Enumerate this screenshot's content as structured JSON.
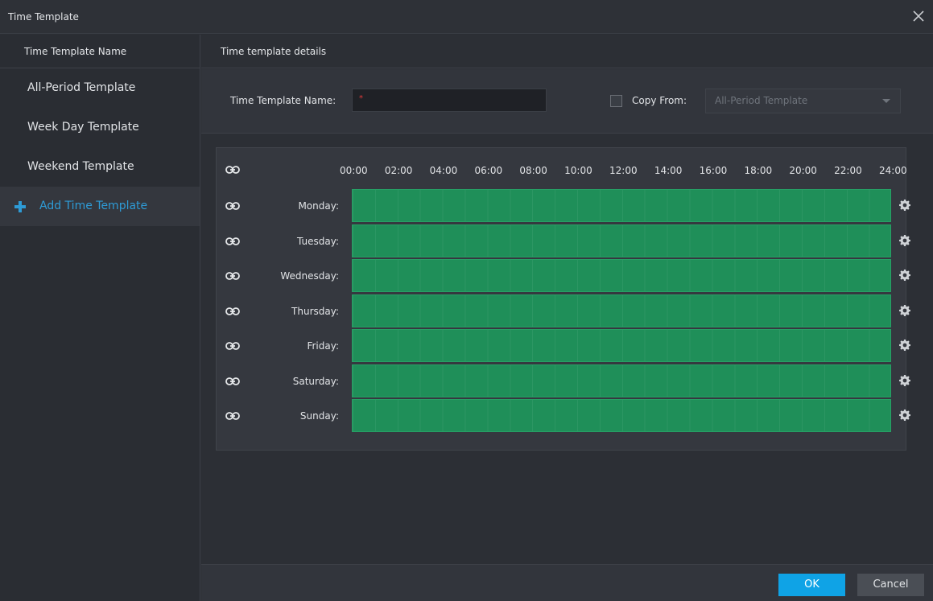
{
  "window": {
    "title": "Time Template"
  },
  "sidebar": {
    "header": "Time Template Name",
    "items": [
      {
        "label": "All-Period Template"
      },
      {
        "label": "Week Day Template"
      },
      {
        "label": "Weekend Template"
      }
    ],
    "add_label": "Add Time Template"
  },
  "details": {
    "header": "Time template details",
    "name_label": "Time Template Name:",
    "name_value": "",
    "required_mark": "*",
    "copy_from_label": "Copy From:",
    "copy_from_checked": false,
    "copy_from_selected": "All-Period Template"
  },
  "schedule": {
    "hours": [
      "00:00",
      "02:00",
      "04:00",
      "06:00",
      "08:00",
      "10:00",
      "12:00",
      "14:00",
      "16:00",
      "18:00",
      "20:00",
      "22:00",
      "24:00"
    ],
    "days": [
      {
        "label": "Monday:",
        "start": "00:00",
        "end": "24:00"
      },
      {
        "label": "Tuesday:",
        "start": "00:00",
        "end": "24:00"
      },
      {
        "label": "Wednesday:",
        "start": "00:00",
        "end": "24:00"
      },
      {
        "label": "Thursday:",
        "start": "00:00",
        "end": "24:00"
      },
      {
        "label": "Friday:",
        "start": "00:00",
        "end": "24:00"
      },
      {
        "label": "Saturday:",
        "start": "00:00",
        "end": "24:00"
      },
      {
        "label": "Sunday:",
        "start": "00:00",
        "end": "24:00"
      }
    ],
    "bar_color": "#1f8f59"
  },
  "footer": {
    "ok_label": "OK",
    "cancel_label": "Cancel"
  },
  "colors": {
    "accent": "#0fa3e6",
    "link": "#2e9bd6",
    "required": "#e03a3a"
  }
}
